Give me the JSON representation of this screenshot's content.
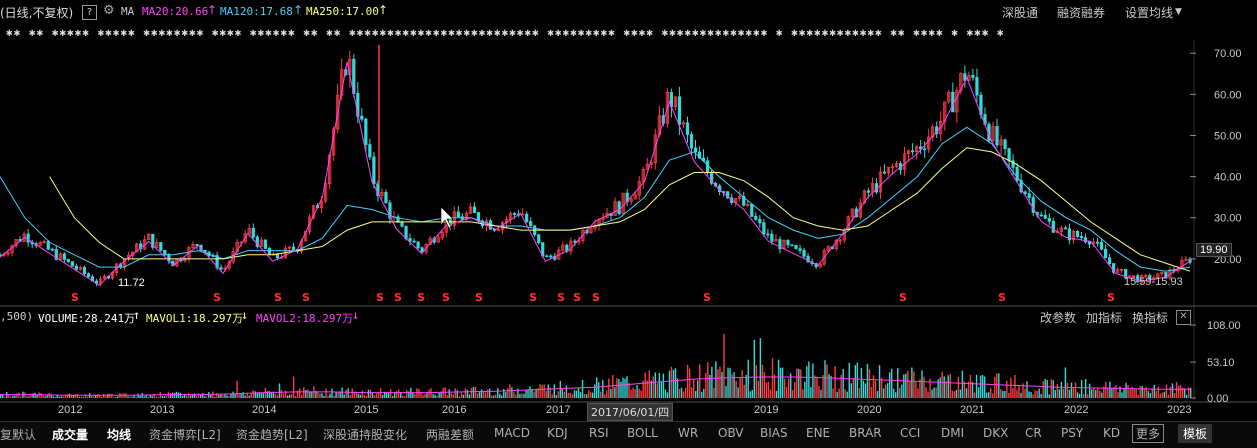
{
  "topbar": {
    "period": "(日线,不复权)",
    "help": "?",
    "ma_label": "MA",
    "ma20": "MA20:20.66",
    "ma120": "MA120:17.68",
    "ma250": "MA250:17.00",
    "hk_connect": "深股通",
    "margin": "融资融券",
    "set_ma": "设置均线"
  },
  "marquee": "✱✱ ✱✱  ✱✱✱✱✱ ✱✱✱✱✱ ✱✱✱✱✱✱✱✱ ✱✱✱✱ ✱✱✱✱✱✱ ✱✱ ✱✱ ✱✱✱✱✱✱✱✱✱✱✱✱✱✱✱✱✱✱✱✱✱✱✱✱✱ ✱✱✱✱✱✱✱✱✱ ✱✱✱✱ ✱✱✱✱✱✱✱✱✱✱✱✱✱✱ ✱ ✱✱✱✱✱✱✱✱✱✱✱✱ ✱✱ ✱✱✱✱  ✱  ✱✱✱  ✱",
  "price_axis": [
    "70.00",
    "60.00",
    "50.00",
    "40.00",
    "30.00",
    "20.00"
  ],
  "last_price": "19.90",
  "low_marker": "11.72",
  "range_label": "15.59-15.93",
  "signal_mark": "S",
  "volume_bar": {
    "prefix": ",500)",
    "volume": "VOLUME:28.241万",
    "mavol1": "MAVOL1:18.297万",
    "mavol2": "MAVOL2:18.297万",
    "btn_params": "改参数",
    "btn_add": "加指标",
    "btn_switch": "换指标",
    "close": "✕"
  },
  "vol_axis": [
    "108.00",
    "53.10",
    "0.00"
  ],
  "years": [
    "2012",
    "2013",
    "2014",
    "2015",
    "2016",
    "2017",
    "2019",
    "2020",
    "2021",
    "2022",
    "2023"
  ],
  "cursor_date": "2017/06/01/四",
  "tabs": [
    "复默认",
    "成交量",
    "均线",
    "资金博弈[L2]",
    "资金趋势[L2]",
    "深股通持股变化",
    "两融差额",
    "MACD",
    "KDJ",
    "RSI",
    "BOLL",
    "WR",
    "OBV",
    "BIAS",
    "ENE",
    "BRAR",
    "CCI",
    "DMI",
    "DKX",
    "CR",
    "PSY",
    "KD",
    "更多",
    "模板"
  ],
  "colors": {
    "up": "#ff3c3c",
    "down": "#34d9d9",
    "ma20": "#ff40ff",
    "ma120": "#40d0ff",
    "ma250": "#ffff80",
    "vol_ma": "#ff40ff",
    "signal": "#ff3030"
  },
  "chart_data": {
    "type": "line",
    "price_range": [
      10,
      72
    ],
    "x": [
      "2011.8",
      "2012.0",
      "2012.3",
      "2012.6",
      "2012.9",
      "2013.1",
      "2013.4",
      "2013.7",
      "2014.0",
      "2014.3",
      "2014.6",
      "2014.9",
      "2015.1",
      "2015.3",
      "2015.4",
      "2015.5",
      "2015.7",
      "2015.9",
      "2016.1",
      "2016.3",
      "2016.6",
      "2016.9",
      "2017.1",
      "2017.3",
      "2017.5",
      "2017.8",
      "2018.0",
      "2018.2",
      "2018.4",
      "2018.7",
      "2018.9",
      "2019.1",
      "2019.3",
      "2019.6",
      "2019.9",
      "2020.1",
      "2020.3",
      "2020.5",
      "2020.7",
      "2020.9",
      "2021.1",
      "2021.3",
      "2021.6",
      "2021.9",
      "2022.2",
      "2022.4",
      "2022.7",
      "2022.9",
      "2023.1"
    ],
    "series": [
      {
        "name": "MA20",
        "values": [
          21,
          26,
          22,
          18,
          14,
          20,
          25,
          19,
          24,
          17,
          27,
          20,
          23,
          36,
          70,
          40,
          28,
          22,
          29,
          31,
          28,
          32,
          20,
          23,
          30,
          33,
          40,
          60,
          45,
          38,
          33,
          25,
          22,
          19,
          27,
          36,
          42,
          47,
          54,
          66,
          50,
          40,
          30,
          26,
          25,
          17,
          15,
          16,
          20
        ]
      },
      {
        "name": "MA120",
        "values": [
          40,
          30,
          24,
          21,
          18,
          18,
          21,
          21,
          22,
          20,
          22,
          22,
          22,
          25,
          33,
          32,
          30,
          29,
          30,
          30,
          28,
          28,
          27,
          27,
          28,
          30,
          35,
          44,
          46,
          40,
          35,
          30,
          27,
          25,
          26,
          30,
          35,
          40,
          48,
          52,
          48,
          40,
          34,
          30,
          27,
          22,
          18,
          17,
          18
        ]
      },
      {
        "name": "MA250",
        "values": [
          null,
          null,
          40,
          30,
          24,
          20,
          20,
          20,
          20,
          20,
          21,
          21,
          22,
          23,
          27,
          29,
          29,
          29,
          29,
          29,
          28,
          27,
          27,
          27,
          28,
          29,
          32,
          38,
          41,
          41,
          39,
          35,
          30,
          28,
          27,
          28,
          32,
          36,
          42,
          47,
          46,
          43,
          39,
          34,
          29,
          25,
          21,
          19,
          17
        ]
      }
    ],
    "volume_range": [
      0,
      108
    ],
    "volume_ma": [
      5,
      5,
      4,
      4,
      4,
      5,
      5,
      6,
      8,
      9,
      9,
      8,
      8,
      8,
      9,
      10,
      12,
      14,
      16,
      20,
      24,
      28,
      30,
      31,
      31,
      30,
      28,
      26,
      24,
      22,
      20,
      18,
      16,
      15,
      14,
      13,
      13
    ]
  }
}
